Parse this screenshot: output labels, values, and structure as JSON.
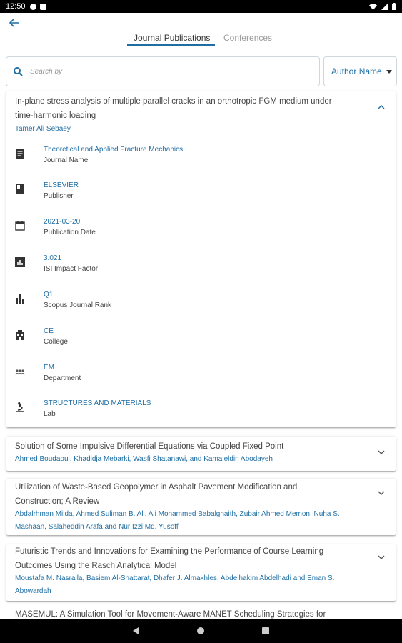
{
  "status_bar": {
    "time": "12:50"
  },
  "tabs": [
    {
      "label": "Journal Publications",
      "active": true
    },
    {
      "label": "Conferences",
      "active": false
    }
  ],
  "search": {
    "placeholder": "Search by",
    "value": ""
  },
  "filter": {
    "selected": "Author Name"
  },
  "expanded_publication": {
    "title_line1": "In-plane stress analysis of multiple parallel cracks in an orthotropic FGM medium under",
    "title_line2": "time-harmonic loading",
    "authors": "Tamer Ali Sebaey",
    "details": [
      {
        "icon": "document-icon",
        "value": "Theoretical and Applied Fracture Mechanics",
        "label": "Journal Name"
      },
      {
        "icon": "book-icon",
        "value": "ELSEVIER",
        "label": "Publisher"
      },
      {
        "icon": "calendar-icon",
        "value": "2021-03-20",
        "label": "Publication Date"
      },
      {
        "icon": "chart-box-icon",
        "value": "3.021",
        "label": "ISI Impact Factor"
      },
      {
        "icon": "bar-chart-icon",
        "value": "Q1",
        "label": "Scopus Journal Rank"
      },
      {
        "icon": "building-icon",
        "value": "CE",
        "label": "College"
      },
      {
        "icon": "people-icon",
        "value": "EM",
        "label": "Department"
      },
      {
        "icon": "microscope-icon",
        "value": "STRUCTURES AND MATERIALS",
        "label": "Lab"
      }
    ]
  },
  "publications": [
    {
      "title_lines": [
        "Solution of Some Impulsive Differential Equations via Coupled Fixed Point"
      ],
      "author_lines": [
        "Ahmed Boudaoui, Khadidja Mebarki, Wasfi Shatanawi, and Kamaleldin Abodayeh"
      ]
    },
    {
      "title_lines": [
        "Utilization of Waste-Based Geopolymer in Asphalt Pavement Modification and",
        "Construction; A Review"
      ],
      "author_lines": [
        "Abdalrhman Milda, Ahmed Suliman B. Ali, Ali Mohammed Babalghaith, Zubair Ahmed Memon, Nuha S.",
        "Mashaan, Salaheddin Arafa and Nur Izzi Md. Yusoff"
      ]
    },
    {
      "title_lines": [
        "Futuristic Trends and Innovations for Examining the Performance of Course Learning",
        "Outcomes Using the Rasch Analytical Model"
      ],
      "author_lines": [
        "Moustafa M. Nasralla, Basiem Al-Shattarat, Dhafer J. Almakhles, Abdelhakim Abdelhadi and Eman S.",
        "Abowardah"
      ]
    }
  ],
  "partial_publication": {
    "title": "MASEMUL: A Simulation Tool for Movement-Aware MANET Scheduling Strategies for"
  },
  "colors": {
    "accent": "#1e6ea3",
    "text": "#444444",
    "border": "#cfd6dc"
  }
}
